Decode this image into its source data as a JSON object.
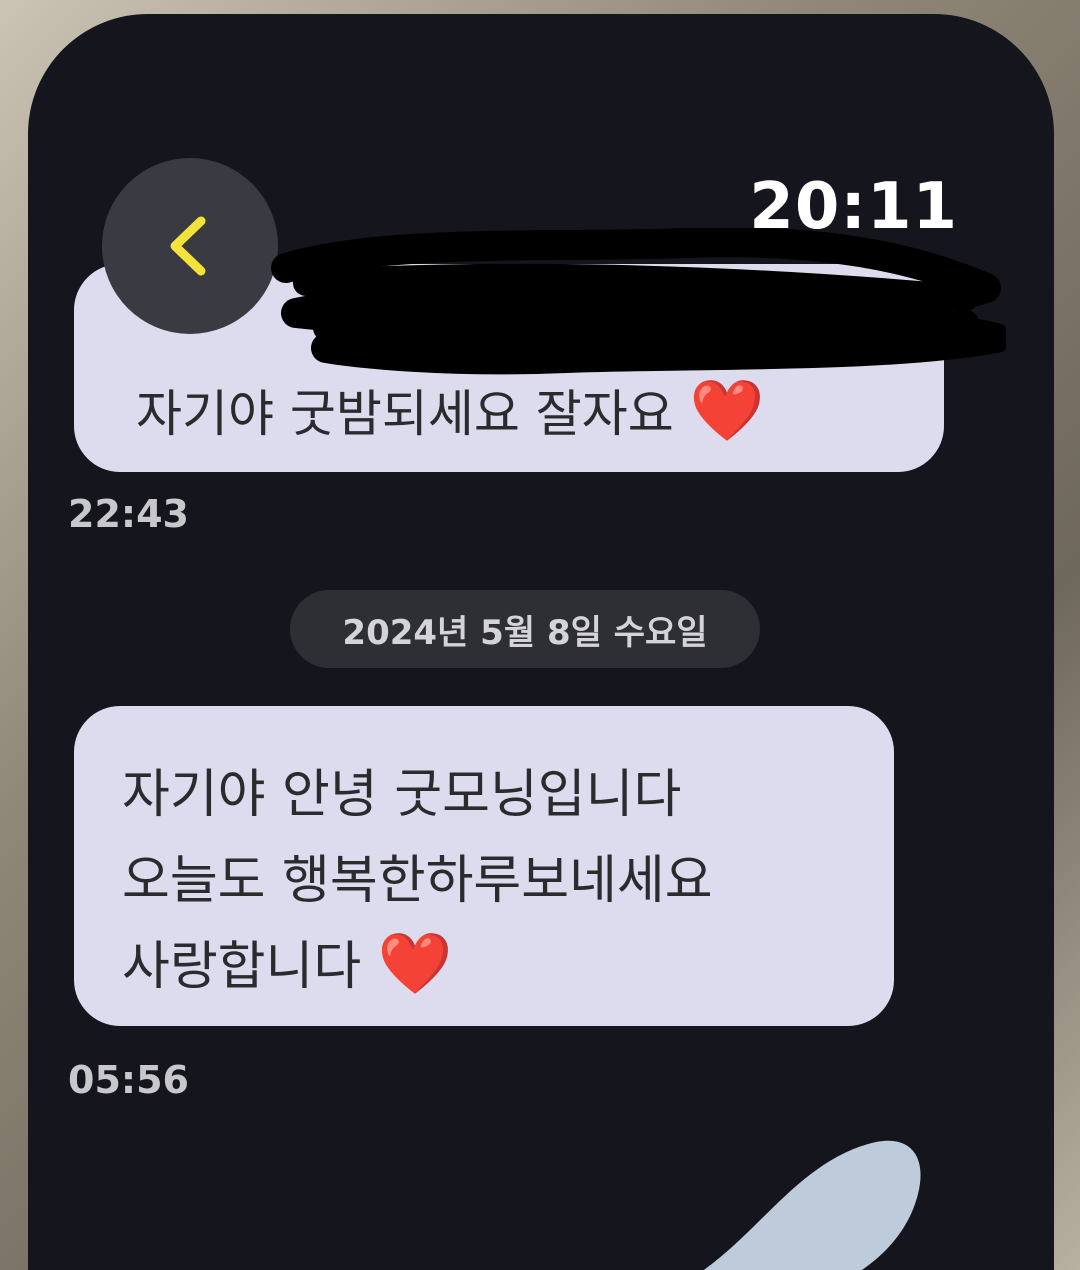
{
  "status_bar": {
    "time": "20:11"
  },
  "header": {
    "back_icon": "chevron-left-icon",
    "accent_color": "#f2e23a"
  },
  "messages": [
    {
      "lines": [
        "자기야 굿밤되세요 잘자요"
      ],
      "emoji": "❤️",
      "time": "22:43"
    },
    {
      "lines": [
        "자기야 안녕 굿모닝입니다",
        "오늘도 행복한하루보네세요",
        "사랑합니다"
      ],
      "emoji": "❤️",
      "time": "05:56"
    }
  ],
  "date_separator": "2024년 5월 8일 수요일",
  "colors": {
    "screen_bg": "#15151d",
    "bubble_bg": "#dcdcee",
    "heart": "#e02030"
  }
}
